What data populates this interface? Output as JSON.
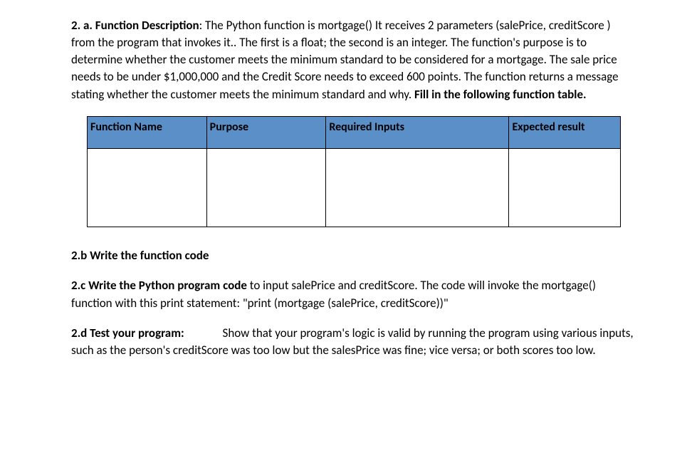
{
  "q2a": {
    "label": "2. a. Function Description",
    "body_part1": ": The Python function is mortgage()   It receives 2 parameters (salePrice, creditScore ) from the program that invokes it.. The first is a float; the second is an integer. The function's purpose is to determine whether the customer meets  the minimum standard to be considered for a mortgage.    The sale price needs to be under $1,000,000 and the Credit Score needs to exceed 600 points.   The function returns a message stating whether the customer meets the minimum standard and why.  ",
    "body_bold_end": "Fill in the following function table."
  },
  "table": {
    "headers": {
      "name": "Function Name",
      "purpose": "Purpose",
      "inputs": "Required Inputs",
      "result": "Expected result"
    },
    "cells": {
      "name": "",
      "purpose": "",
      "inputs": "",
      "result": ""
    }
  },
  "q2b": {
    "label": "2.b Write the function code"
  },
  "q2c": {
    "label": "2.c Write the Python program code",
    "body": " to input salePrice and creditScore. The code will invoke the mortgage() function with this print statement:    \"print (mortgage (salePrice, creditScore))\""
  },
  "q2d": {
    "label": "2.d  Test your program:",
    "body": "              Show that your program's logic is valid by running the program using various inputs, such as the person's creditScore was too low but the salesPrice was fine; vice versa; or both scores too low."
  }
}
